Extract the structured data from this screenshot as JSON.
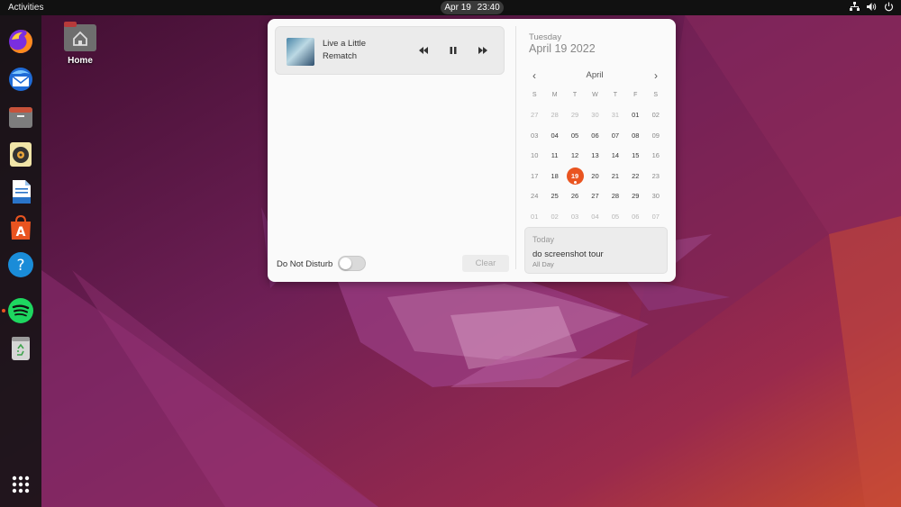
{
  "topbar": {
    "activities": "Activities",
    "date": "Apr 19",
    "time": "23:40",
    "tray_icons": [
      "network-icon",
      "volume-icon",
      "power-icon"
    ]
  },
  "dock": {
    "apps": [
      {
        "name": "firefox",
        "icon": "firefox-icon"
      },
      {
        "name": "thunderbird",
        "icon": "thunderbird-icon"
      },
      {
        "name": "files",
        "icon": "files-icon"
      },
      {
        "name": "rhythmbox",
        "icon": "rhythmbox-icon"
      },
      {
        "name": "writer",
        "icon": "libreoffice-writer-icon"
      },
      {
        "name": "software",
        "icon": "app-center-icon"
      },
      {
        "name": "help",
        "icon": "help-icon"
      },
      {
        "name": "spotify",
        "icon": "spotify-icon",
        "running": true
      },
      {
        "name": "trash",
        "icon": "trash-icon"
      }
    ],
    "show_apps_icon": "app-grid-icon"
  },
  "desktop": {
    "home_label": "Home"
  },
  "notifications": {
    "media": {
      "title": "Live a Little",
      "artist": "Rematch"
    },
    "dnd_label": "Do Not Disturb",
    "dnd_enabled": false,
    "clear_label": "Clear"
  },
  "calendar": {
    "weekday": "Tuesday",
    "full_date": "April 19 2022",
    "month": "April",
    "prev": "‹",
    "next": "›",
    "headers": [
      "S",
      "M",
      "T",
      "W",
      "T",
      "F",
      "S"
    ],
    "weeks": [
      [
        "27",
        "28",
        "29",
        "30",
        "31",
        "01",
        "02"
      ],
      [
        "03",
        "04",
        "05",
        "06",
        "07",
        "08",
        "09"
      ],
      [
        "10",
        "11",
        "12",
        "13",
        "14",
        "15",
        "16"
      ],
      [
        "17",
        "18",
        "19",
        "20",
        "21",
        "22",
        "23"
      ],
      [
        "24",
        "25",
        "26",
        "27",
        "28",
        "29",
        "30"
      ],
      [
        "01",
        "02",
        "03",
        "04",
        "05",
        "06",
        "07"
      ]
    ],
    "today": "19",
    "accent": "#e95420",
    "events": {
      "heading": "Today",
      "title": "do screenshot tour",
      "time": "All Day"
    }
  }
}
